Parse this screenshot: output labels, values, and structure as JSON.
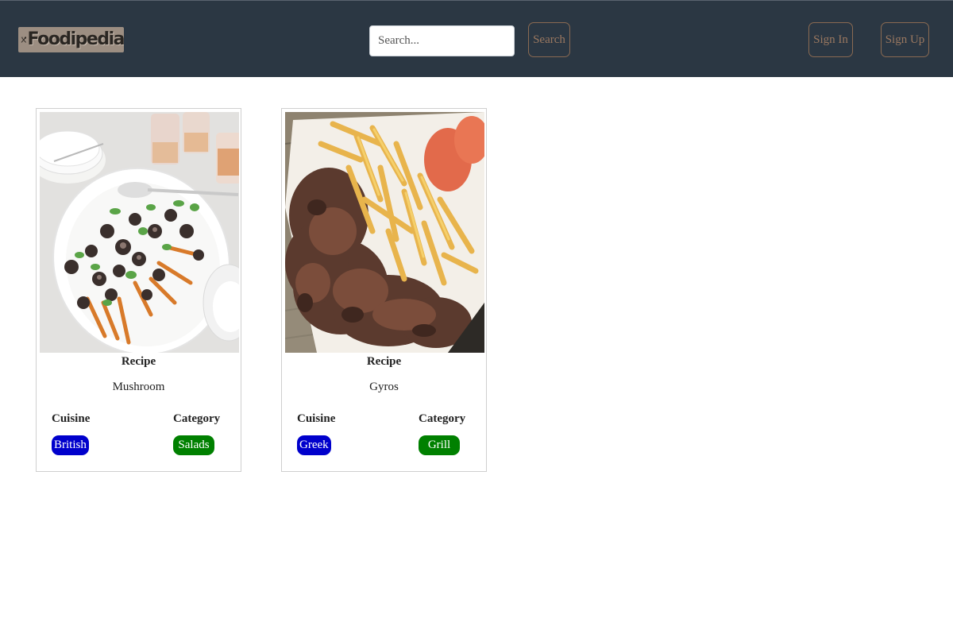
{
  "brand": {
    "name": "Foodipedia"
  },
  "nav": {
    "search_placeholder": "Search...",
    "search_value": "",
    "search_button": "Search",
    "sign_in": "Sign In",
    "sign_up": "Sign Up"
  },
  "colors": {
    "navbar_bg": "#2b3743",
    "outline_button": "#9a7860",
    "cuisine_badge": "#0000cc",
    "category_badge": "#008000"
  },
  "recipes": [
    {
      "heading": "Recipe",
      "name": "Mushroom",
      "cuisine_label": "Cuisine",
      "cuisine": "British",
      "category_label": "Category",
      "category": "Salads",
      "image": "roasted-carrots-mushroom-salad-platter"
    },
    {
      "heading": "Recipe",
      "name": "Gyros",
      "cuisine_label": "Cuisine",
      "cuisine": "Greek",
      "category_label": "Category",
      "category": "Grill",
      "image": "gyros-meat-with-fries"
    }
  ]
}
